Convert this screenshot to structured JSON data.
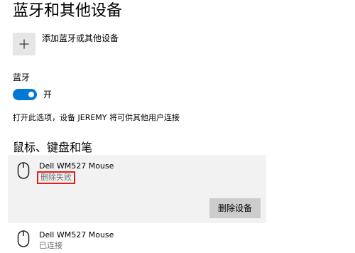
{
  "page": {
    "title": "蓝牙和其他设备"
  },
  "add_device": {
    "icon": "plus-icon",
    "label": "添加蓝牙或其他设备"
  },
  "bluetooth": {
    "label": "蓝牙",
    "toggle_state": "开",
    "toggle_on": true,
    "accent_color": "#0078d7",
    "discoverable_text": "打开此选项，设备 JEREMY 将可供其他用户连接"
  },
  "mouse_section": {
    "heading": "鼠标、键盘和笔",
    "devices": [
      {
        "name": "Dell WM527 Mouse",
        "status": "删除失败",
        "icon": "mouse-icon",
        "selected": true,
        "status_highlight_color": "#e0201b",
        "remove_button_label": "删除设备"
      },
      {
        "name": "Dell WM527 Mouse",
        "status": "已连接",
        "icon": "mouse-icon",
        "selected": false
      }
    ]
  }
}
